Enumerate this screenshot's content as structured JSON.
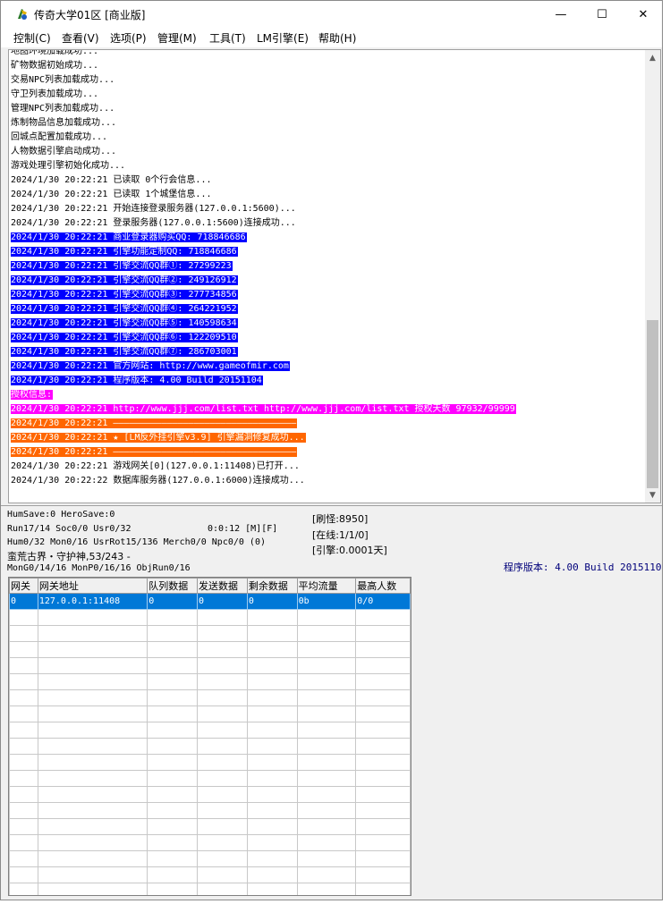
{
  "window": {
    "title": "传奇大学01区 [商业版]",
    "controls": {
      "minimize": "—",
      "maximize": "☐",
      "close": "✕"
    }
  },
  "menu": [
    "控制(C)",
    "查看(V)",
    "选项(P)",
    "管理(M)",
    "工具(T)",
    "LM引擎(E)",
    "帮助(H)"
  ],
  "log": [
    {
      "text": "地图环境加载成功...",
      "style": "plain"
    },
    {
      "text": "矿物数据初始成功...",
      "style": "plain"
    },
    {
      "text": "交易NPC列表加载成功...",
      "style": "plain"
    },
    {
      "text": "守卫列表加载成功...",
      "style": "plain"
    },
    {
      "text": "管理NPC列表加载成功...",
      "style": "plain"
    },
    {
      "text": "炼制物品信息加载成功...",
      "style": "plain"
    },
    {
      "text": "回城点配置加载成功...",
      "style": "plain"
    },
    {
      "text": "人物数据引擎启动成功...",
      "style": "plain"
    },
    {
      "text": "游戏处理引擎初始化成功...",
      "style": "plain"
    },
    {
      "text": "2024/1/30 20:22:21 已读取 0个行会信息...",
      "style": "plain"
    },
    {
      "text": "2024/1/30 20:22:21 已读取 1个城堡信息...",
      "style": "plain"
    },
    {
      "text": "2024/1/30 20:22:21 开始连接登录服务器(127.0.0.1:5600)...",
      "style": "plain"
    },
    {
      "text": "2024/1/30 20:22:21 登录服务器(127.0.0.1:5600)连接成功...",
      "style": "plain"
    },
    {
      "text": "2024/1/30 20:22:21 商业登录器购买QQ: 718846686",
      "style": "blue"
    },
    {
      "text": "2024/1/30 20:22:21 引擎功能定制QQ: 718846686",
      "style": "blue"
    },
    {
      "text": "2024/1/30 20:22:21 引擎交流QQ群①: 27299223",
      "style": "blue"
    },
    {
      "text": "2024/1/30 20:22:21 引擎交流QQ群②: 249126912",
      "style": "blue"
    },
    {
      "text": "2024/1/30 20:22:21 引擎交流QQ群③: 277734856",
      "style": "blue"
    },
    {
      "text": "2024/1/30 20:22:21 引擎交流QQ群④: 264221952",
      "style": "blue"
    },
    {
      "text": "2024/1/30 20:22:21 引擎交流QQ群⑤: 140598634",
      "style": "blue"
    },
    {
      "text": "2024/1/30 20:22:21 引擎交流QQ群⑥: 122209510",
      "style": "blue"
    },
    {
      "text": "2024/1/30 20:22:21 引擎交流QQ群⑦: 286703001",
      "style": "blue"
    },
    {
      "text": "2024/1/30 20:22:21 官方网站: http://www.gameofmir.com",
      "style": "blue"
    },
    {
      "text": "2024/1/30 20:22:21 程序版本: 4.00 Build 20151104",
      "style": "blue"
    },
    {
      "text": "授权信息:",
      "style": "magenta"
    },
    {
      "text": "2024/1/30 20:22:21 http://www.jjj.com/list.txt http://www.jjj.com/list.txt 授权天数 97932/99999",
      "style": "magenta"
    },
    {
      "text": "2024/1/30 20:22:21 ——————————————————————————————————",
      "style": "orange"
    },
    {
      "text": "2024/1/30 20:22:21 ★ [LM反外挂引擎v3.9] 引擎漏洞修复成功...",
      "style": "orange"
    },
    {
      "text": "2024/1/30 20:22:21 ——————————————————————————————————",
      "style": "orange"
    },
    {
      "text": "2024/1/30 20:22:21 游戏网关[0](127.0.0.1:11408)已打开...",
      "style": "plain"
    },
    {
      "text": "2024/1/30 20:22:22 数据库服务器(127.0.0.1:6000)连接成功...",
      "style": "plain"
    }
  ],
  "status": {
    "line1": "HumSave:0 HeroSave:0",
    "line2a": "Run17/14 Soc0/0 Usr0/32",
    "line2b": "0:0:12 [M][F]",
    "line3": "Hum0/32 Mon0/16 UsrRot15/136 Merch0/0 Npc0/0 (0)",
    "line4": "蛮荒古界・守护神,53/243 -",
    "line5": "MonG0/14/16 MonP0/16/16 ObjRun0/16",
    "refresh": "[刷怪:8950]",
    "online": "[在线:1/1/0]",
    "engine": "[引擎:0.0001天]",
    "version": "程序版本: 4.00 Build 20151104"
  },
  "grid": {
    "columns": [
      "网关",
      "网关地址",
      "队列数据",
      "发送数据",
      "剩余数据",
      "平均流量",
      "最高人数"
    ],
    "rows": [
      [
        "0",
        "127.0.0.1:11408",
        "0",
        "0",
        "0",
        "0b",
        "0/0"
      ]
    ],
    "empty_rows": 18
  },
  "colors": {
    "blue_hl": "#0000ff",
    "magenta_hl": "#ff00ff",
    "orange_hl": "#ff6600",
    "selection": "#0078d7"
  }
}
